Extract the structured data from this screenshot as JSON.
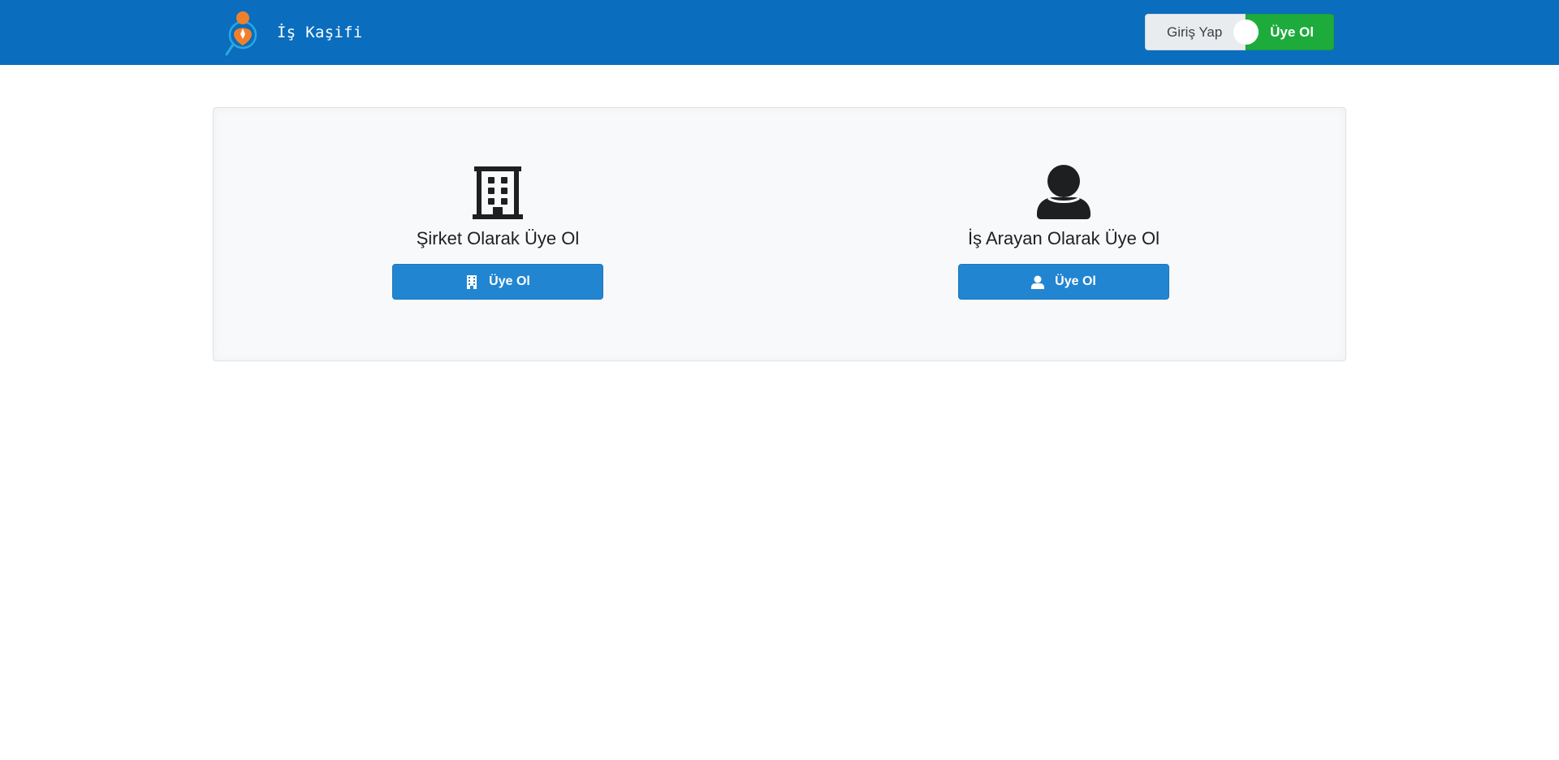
{
  "navbar": {
    "brand_text": "İş Kaşifi",
    "login_label": "Giriş Yap",
    "register_label": "Üye Ol",
    "colors": {
      "background": "#0a6dbd",
      "register": "#1dab3c",
      "login": "#e9ecef",
      "logo_accent": "#f07f2c"
    }
  },
  "options": {
    "company": {
      "icon": "building-icon",
      "title": "Şirket Olarak Üye Ol",
      "button_label": "Üye Ol"
    },
    "seeker": {
      "icon": "user-icon",
      "title": "İş Arayan Olarak Üye Ol",
      "button_label": "Üye Ol"
    },
    "colors": {
      "button": "#2285d1",
      "card_background": "#f8f9fa"
    }
  }
}
